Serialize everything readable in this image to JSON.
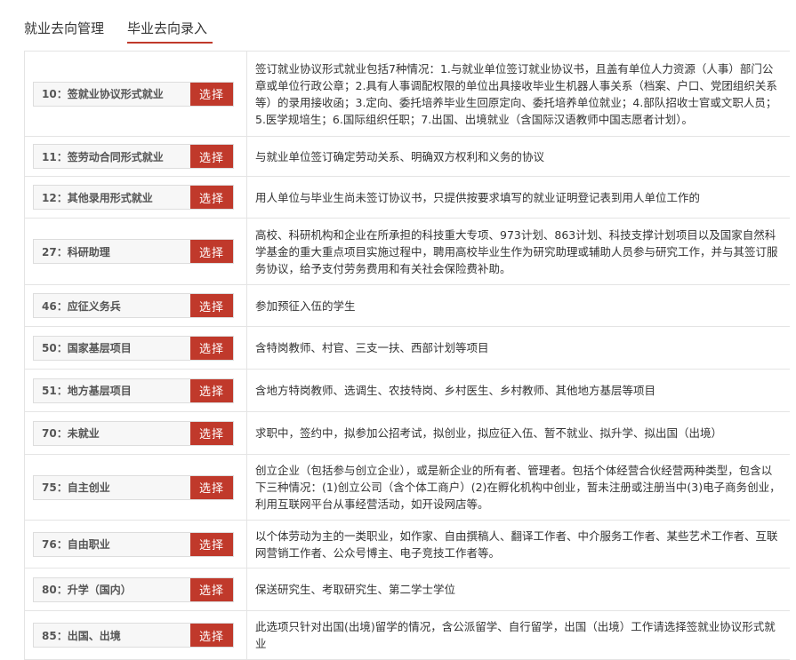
{
  "tabs": [
    {
      "label": "就业去向管理"
    },
    {
      "label": "毕业去向录入"
    }
  ],
  "select_label": "选择",
  "rows": [
    {
      "code": "10：签就业协议形式就业",
      "desc": "签订就业协议形式就业包括7种情况：1.与就业单位签订就业协议书，且盖有单位人力资源（人事）部门公章或单位行政公章；2.具有人事调配权限的单位出具接收毕业生机器人事关系（档案、户口、党团组织关系等）的录用接收函；3.定向、委托培养毕业生回原定向、委托培养单位就业；4.部队招收士官或文职人员；5.医学规培生；6.国际组织任职；7.出国、出境就业（含国际汉语教师中国志愿者计划）。"
    },
    {
      "code": "11：签劳动合同形式就业",
      "desc": "与就业单位签订确定劳动关系、明确双方权利和义务的协议"
    },
    {
      "code": "12：其他录用形式就业",
      "desc": "用人单位与毕业生尚未签订协议书，只提供按要求填写的就业证明登记表到用人单位工作的"
    },
    {
      "code": "27：科研助理",
      "desc": "高校、科研机构和企业在所承担的科技重大专项、973计划、863计划、科技支撑计划项目以及国家自然科学基金的重大重点项目实施过程中，聘用高校毕业生作为研究助理或辅助人员参与研究工作，并与其签订服务协议，给予支付劳务费用和有关社会保险费补助。"
    },
    {
      "code": "46：应征义务兵",
      "desc": "参加预征入伍的学生"
    },
    {
      "code": "50：国家基层项目",
      "desc": "含特岗教师、村官、三支一扶、西部计划等项目"
    },
    {
      "code": "51：地方基层项目",
      "desc": "含地方特岗教师、选调生、农技特岗、乡村医生、乡村教师、其他地方基层等项目"
    },
    {
      "code": "70：未就业",
      "desc": "求职中，签约中，拟参加公招考试，拟创业，拟应征入伍、暂不就业、拟升学、拟出国（出境）"
    },
    {
      "code": "75：自主创业",
      "desc": "创立企业（包括参与创立企业），或是新企业的所有者、管理者。包括个体经营合伙经营两种类型，包含以下三种情况：(1)创立公司（含个体工商户）(2)在孵化机构中创业，暂未注册或注册当中(3)电子商务创业，利用互联网平台从事经营活动，如开设网店等。"
    },
    {
      "code": "76：自由职业",
      "desc": "以个体劳动为主的一类职业，如作家、自由撰稿人、翻译工作者、中介服务工作者、某些艺术工作者、互联网营销工作者、公众号博主、电子竞技工作者等。"
    },
    {
      "code": "80：升学（国内）",
      "desc": "保送研究生、考取研究生、第二学士学位"
    },
    {
      "code": "85：出国、出境",
      "desc": "此选项只针对出国(出境)留学的情况，含公派留学、自行留学，出国（出境）工作请选择签就业协议形式就业"
    }
  ]
}
